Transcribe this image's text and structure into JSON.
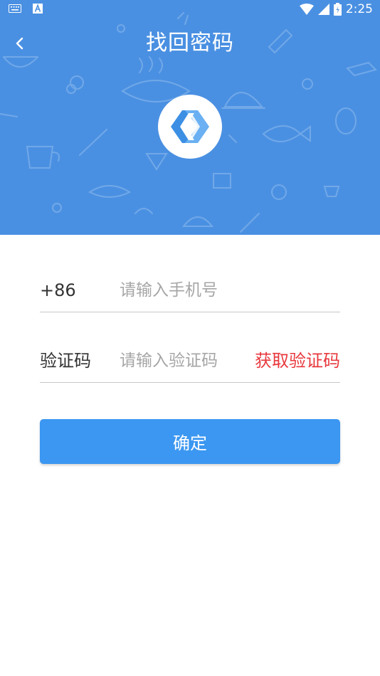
{
  "status_bar": {
    "time": "2:25",
    "icons": [
      "keyboard-icon",
      "a-icon",
      "wifi-icon",
      "signal-icon",
      "battery-icon"
    ]
  },
  "header": {
    "title": "找回密码",
    "back_icon": "chevron-left-icon",
    "background_color": "#4a90e2"
  },
  "form": {
    "phone": {
      "prefix": "+86",
      "placeholder": "请输入手机号",
      "value": ""
    },
    "code": {
      "label": "验证码",
      "placeholder": "请输入验证码",
      "value": "",
      "get_code_label": "获取验证码",
      "get_code_color": "#e8383d"
    },
    "confirm_label": "确定",
    "confirm_color": "#3b97f1"
  }
}
